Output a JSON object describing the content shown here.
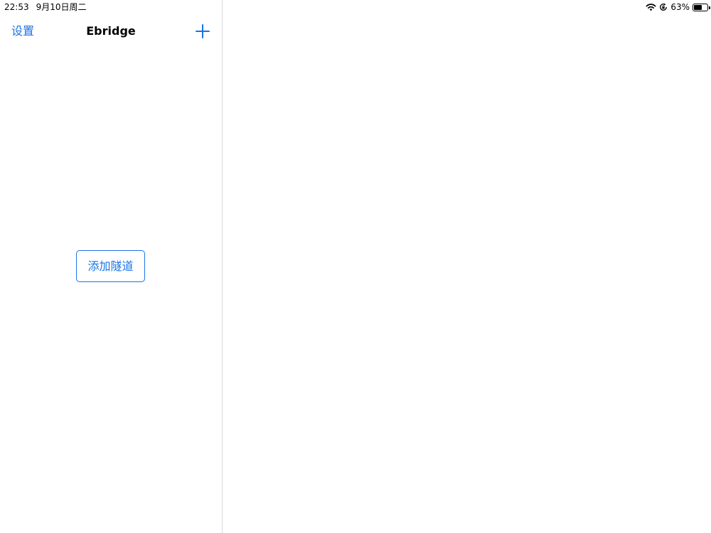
{
  "status_bar": {
    "time": "22:53",
    "date": "9月10日周二",
    "battery_percent_text": "63%",
    "battery_level": 0.63,
    "icons": [
      "wifi-icon",
      "screen-rotation-lock-icon",
      "battery-icon"
    ]
  },
  "sidebar": {
    "nav": {
      "left_label": "设置",
      "title": "Ebridge",
      "add_icon": "plus-icon"
    },
    "empty_state": {
      "button_label": "添加隧道"
    }
  },
  "colors": {
    "accent": "#1a73e8",
    "divider": "#d8d8d8",
    "background": "#ffffff"
  }
}
